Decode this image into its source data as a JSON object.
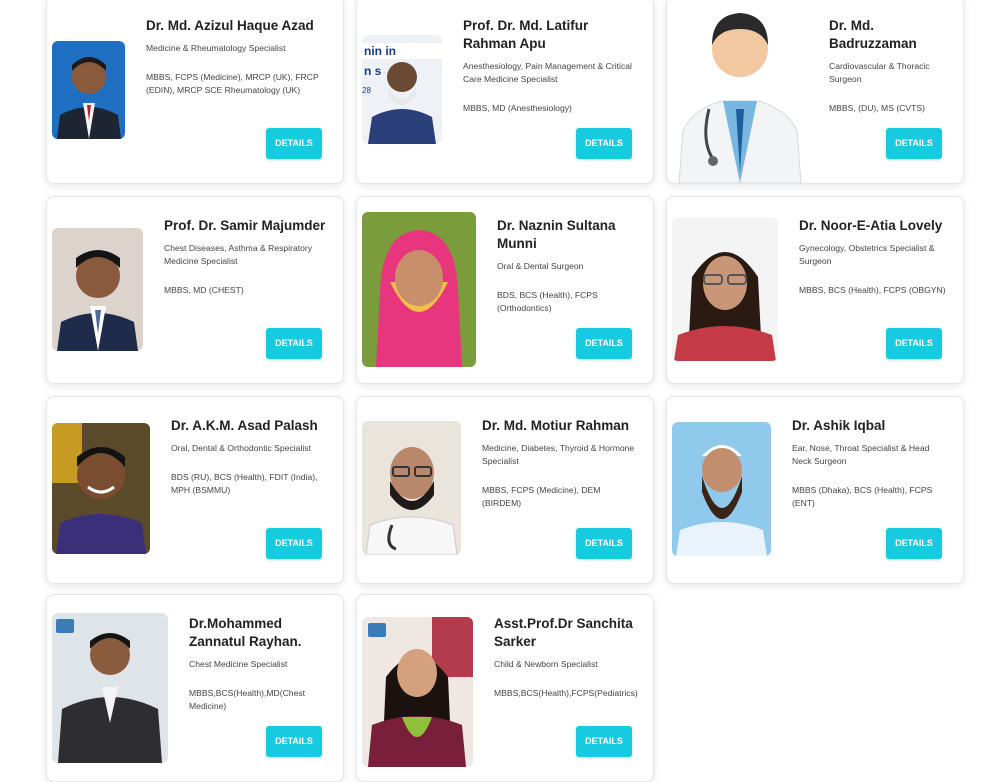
{
  "doctors": [
    {
      "name": "Dr. Md. Azizul Haque Azad",
      "specialty": "Medicine & Rheumatology Specialist",
      "degrees": "MBBS, FCPS (Medicine), MRCP (UK), FRCP (EDIN), MRCP SCE Rheumatology (UK)",
      "button": "DETAILS"
    },
    {
      "name": "Prof. Dr. Md. Latifur Rahman Apu",
      "specialty": "Anesthesiology, Pain Management & Critical Care Medicine Specialist",
      "degrees": "MBBS, MD (Anesthesiology)",
      "button": "DETAILS"
    },
    {
      "name": "Dr. Md. Badruzzaman",
      "specialty": "Cardiovascular & Thoracic Surgeon",
      "degrees": "MBBS, (DU), MS (CVTS)",
      "button": "DETAILS"
    },
    {
      "name": "Prof. Dr. Samir Majumder",
      "specialty": "Chest Diseases, Asthma & Respiratory Medicine Specialist",
      "degrees": "MBBS, MD (CHEST)",
      "button": "DETAILS"
    },
    {
      "name": "Dr. Naznin Sultana Munni",
      "specialty": "Oral & Dental Surgeon",
      "degrees": "BDS, BCS (Health), FCPS (Orthodontics)",
      "button": "DETAILS"
    },
    {
      "name": "Dr. Noor-E-Atia Lovely",
      "specialty": "Gynecology, Obstetrics Specialist & Surgeon",
      "degrees": "MBBS, BCS (Health), FCPS (OBGYN)",
      "button": "DETAILS"
    },
    {
      "name": "Dr. A.K.M. Asad Palash",
      "specialty": "Oral, Dental & Orthodontic Specialist",
      "degrees": "BDS (RU), BCS (Health), FDIT (India), MPH (BSMMU)",
      "button": "DETAILS"
    },
    {
      "name": "Dr. Md. Motiur Rahman",
      "specialty": "Medicine, Diabetes, Thyroid & Hormone Specialist",
      "degrees": "MBBS, FCPS (Medicine), DEM (BIRDEM)",
      "button": "DETAILS"
    },
    {
      "name": "Dr. Ashik Iqbal",
      "specialty": "Ear, Nose, Throat Specialist & Head Neck Surgeon",
      "degrees": "MBBS (Dhaka), BCS (Health), FCPS (ENT)",
      "button": "DETAILS"
    },
    {
      "name": "Dr.Mohammed Zannatul Rayhan.",
      "specialty": "Chest Medicine Specialist",
      "degrees": "MBBS,BCS(Health),MD(Chest Medicine)",
      "button": "DETAILS"
    },
    {
      "name": "Asst.Prof.Dr Sanchita Sarker",
      "specialty": "Child & Newborn Specialist",
      "degrees": "MBBS,BCS(Health),FCPS(Pediatrics)",
      "button": "DETAILS"
    }
  ],
  "colors": {
    "button": "#16cae0",
    "card_border": "#e6e6e6"
  }
}
